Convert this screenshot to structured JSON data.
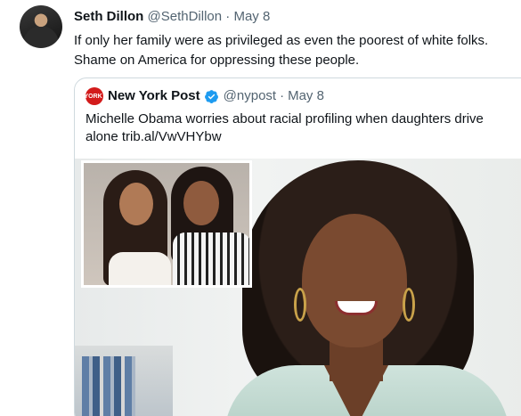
{
  "tweet": {
    "author_name": "Seth Dillon",
    "author_handle": "@SethDillon",
    "separator": "·",
    "date": "May 8",
    "text": "If only her family were as privileged as even the poorest of white folks. Shame on America for oppressing these people."
  },
  "quoted": {
    "avatar_text": "NEW YORK POST",
    "author_name": "New York Post",
    "verified_icon": "verified-badge-icon",
    "author_handle": "@nypost",
    "separator": "·",
    "date": "May 8",
    "text": "Michelle Obama worries about racial profiling when daughters drive alone trib.al/VwVHYbw"
  },
  "colors": {
    "text_primary": "#0f1419",
    "text_secondary": "#536471",
    "border": "#cfd9de",
    "verified_blue": "#1d9bf0",
    "nypost_red": "#d31b1b"
  }
}
